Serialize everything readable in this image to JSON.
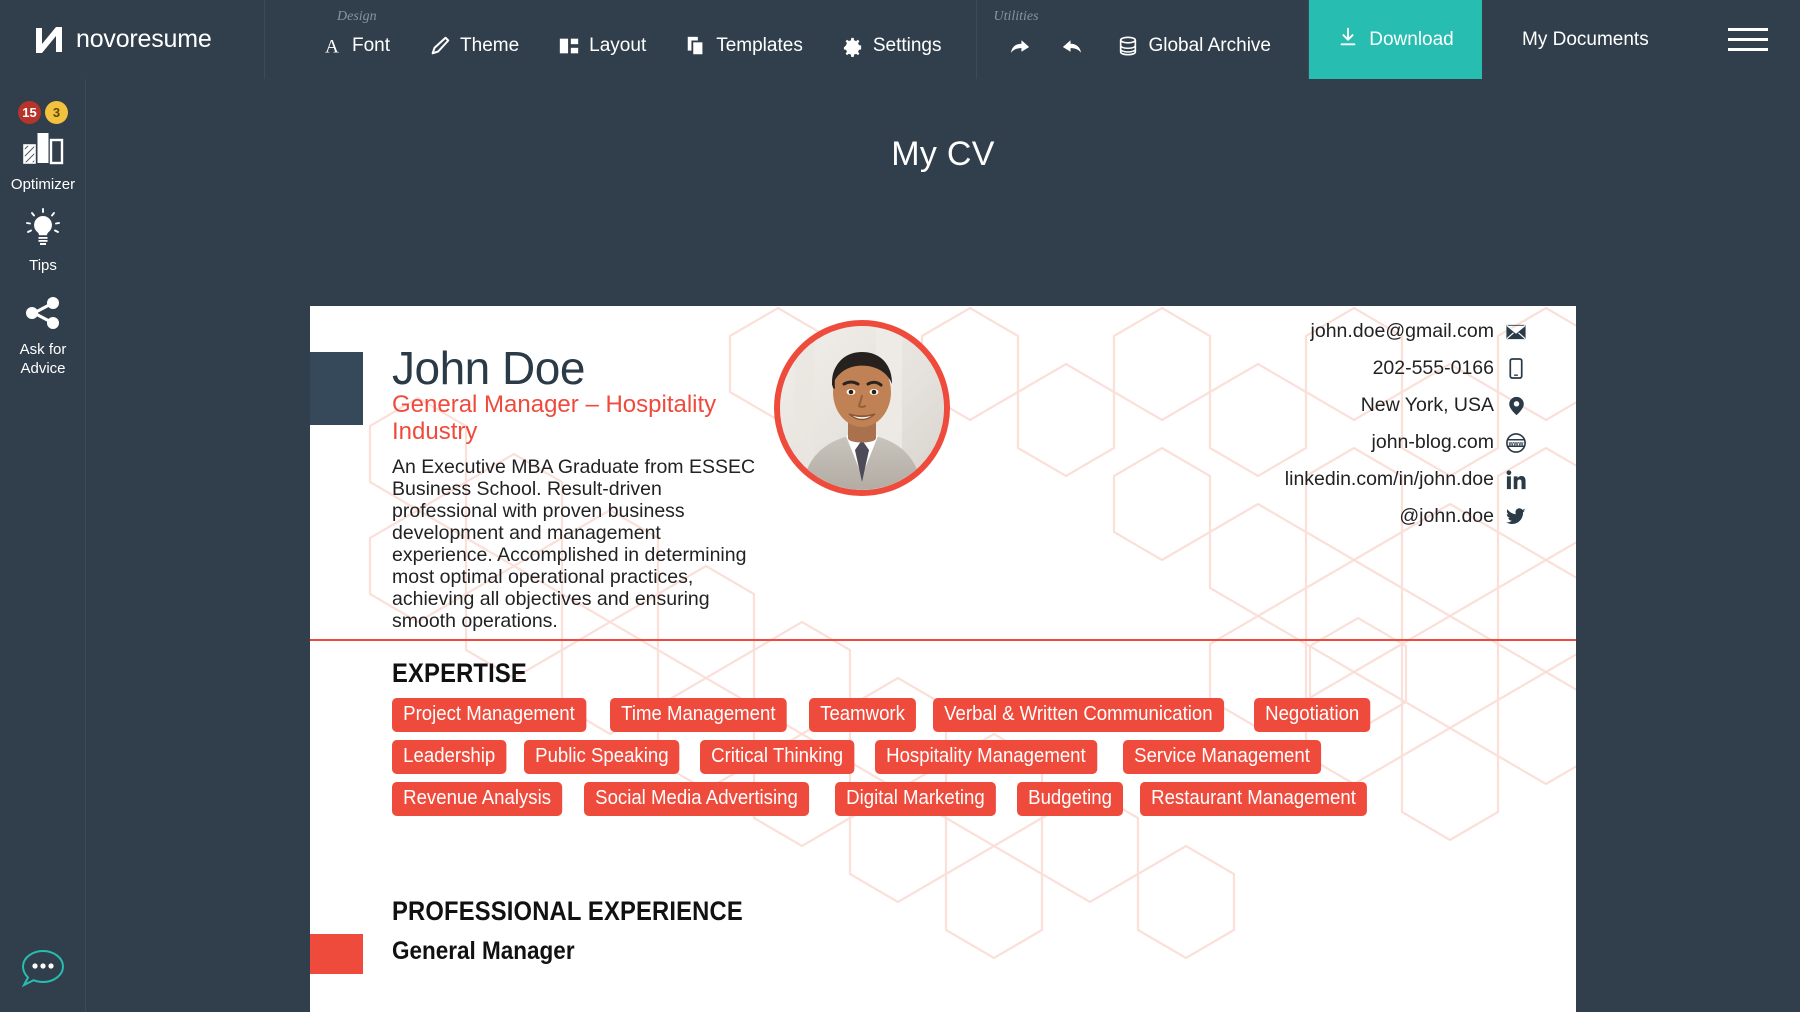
{
  "app": {
    "brand": "novoresume",
    "brand_logo_icon": "novoresume-n-logo"
  },
  "topbar": {
    "groups": [
      {
        "label": "Design",
        "items": [
          {
            "label": "Font",
            "icon": "font-letter-a-icon"
          },
          {
            "label": "Theme",
            "icon": "paintbrush-icon"
          },
          {
            "label": "Layout",
            "icon": "layout-blocks-icon"
          },
          {
            "label": "Templates",
            "icon": "stacked-pages-icon"
          },
          {
            "label": "Settings",
            "icon": "gear-icon"
          }
        ]
      },
      {
        "label": "Utilities",
        "items": [
          {
            "label": "",
            "icon": "undo-arrow-icon"
          },
          {
            "label": "",
            "icon": "redo-arrow-icon"
          },
          {
            "label": "Global Archive",
            "icon": "database-icon"
          }
        ]
      }
    ],
    "download_label": "Download",
    "download_icon": "download-arrow-icon",
    "download_color": "#27bdb0",
    "my_documents_label": "My Documents",
    "menu_icon": "hamburger-menu-icon"
  },
  "sidebar": {
    "items": [
      {
        "label": "Optimizer",
        "icon": "bar-chart-icon",
        "badges": [
          {
            "value": "15",
            "color": "#b7342a"
          },
          {
            "value": "3",
            "color": "#f2c23e"
          }
        ]
      },
      {
        "label": "Tips",
        "icon": "lightbulb-icon",
        "badges": []
      },
      {
        "label": "Ask for Advice",
        "icon": "share-nodes-icon",
        "badges": []
      }
    ],
    "chat_icon": "chat-bubble-dots-icon",
    "chat_color": "#27bdb0"
  },
  "workspace": {
    "document_title": "My CV",
    "background_color": "#313f4c"
  },
  "cv": {
    "accent_color": "#ef4b3c",
    "dark_color": "#36495b",
    "name": "John Doe",
    "role": "General Manager – Hospitality Industry",
    "summary": "An Executive MBA Graduate from ESSEC Business School. Result-driven professional with proven business development and management experience. Accomplished in determining most optimal operational practices, achieving all objectives and ensuring smooth operations.",
    "photo_alt": "profile-photo",
    "contacts": [
      {
        "text": "john.doe@gmail.com",
        "icon": "email-envelope-icon"
      },
      {
        "text": "202-555-0166",
        "icon": "mobile-phone-icon"
      },
      {
        "text": "New York, USA",
        "icon": "location-pin-icon"
      },
      {
        "text": "john-blog.com",
        "icon": "website-www-icon"
      },
      {
        "text": "linkedin.com/in/john.doe",
        "icon": "linkedin-icon"
      },
      {
        "text": "@john.doe",
        "icon": "twitter-bird-icon"
      }
    ],
    "expertise_heading": "EXPERTISE",
    "expertise": [
      "Project Management",
      "Time Management",
      "Teamwork",
      "Verbal & Written Communication",
      "Negotiation",
      "Leadership",
      "Public Speaking",
      "Critical Thinking",
      "Hospitality Management",
      "Service Management",
      "Revenue Analysis",
      "Social Media Advertising",
      "Digital Marketing",
      "Budgeting",
      "Restaurant Management"
    ],
    "experience_heading": "PROFESSIONAL EXPERIENCE",
    "experience_job_title": "General Manager"
  }
}
